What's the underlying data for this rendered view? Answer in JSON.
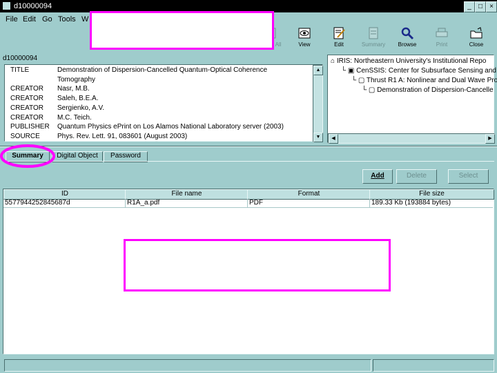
{
  "window": {
    "title": "d10000094",
    "min": "_",
    "max": "□",
    "close": "×"
  },
  "menu": [
    "File",
    "Edit",
    "Go",
    "Tools",
    "W"
  ],
  "toolbar": [
    {
      "label": "Save All",
      "icon": "save-all-icon",
      "enabled": false
    },
    {
      "label": "View",
      "icon": "eye-icon",
      "enabled": true
    },
    {
      "label": "Edit",
      "icon": "edit-icon",
      "enabled": true
    },
    {
      "label": "Summary",
      "icon": "summary-icon",
      "enabled": false
    },
    {
      "label": "Browse",
      "icon": "magnifier-icon",
      "enabled": true
    },
    {
      "label": "Print",
      "icon": "printer-icon",
      "enabled": false
    },
    {
      "label": "Close",
      "icon": "folder-close-icon",
      "enabled": true
    }
  ],
  "metadata": {
    "id": "d10000094",
    "rows": [
      {
        "key": "TITLE",
        "value": "Demonstration of Dispersion-Cancelled Quantum-Optical Coherence"
      },
      {
        "key": "",
        "value": "Tomography"
      },
      {
        "key": "CREATOR",
        "value": "Nasr, M.B."
      },
      {
        "key": "CREATOR",
        "value": "Saleh, B.E.A."
      },
      {
        "key": "CREATOR",
        "value": "Sergienko, A.V."
      },
      {
        "key": "CREATOR",
        "value": "M.C. Teich."
      },
      {
        "key": "PUBLISHER",
        "value": "Quantum Physics ePrint on Los Alamos National Laboratory server (2003)"
      },
      {
        "key": "SOURCE",
        "value": "Phys. Rev. Lett. 91, 083601 (August 2003)"
      }
    ]
  },
  "tree": [
    {
      "label": "IRIS: Northeastern University's Institutional Repo",
      "level": 0
    },
    {
      "label": "CenSSIS: Center for Subsurface Sensing and",
      "level": 1
    },
    {
      "label": "Thrust R1 A: Nonlinear and Dual Wave Pro",
      "level": 2
    },
    {
      "label": "Demonstration of Dispersion-Cancelle",
      "level": 3
    }
  ],
  "tabs": [
    "Summary",
    "Digital Object",
    "Password"
  ],
  "buttons": {
    "add": "Add",
    "delete": "Delete",
    "select": "Select"
  },
  "table": {
    "headers": [
      "ID",
      "File name",
      "Format",
      "File size"
    ],
    "rows": [
      [
        "5577944252845687d",
        "R1A_a.pdf",
        "PDF",
        "189.33 Kb (193884 bytes)"
      ]
    ]
  },
  "colors": {
    "bg": "#9fcccc",
    "highlight": "#ff00ff"
  }
}
